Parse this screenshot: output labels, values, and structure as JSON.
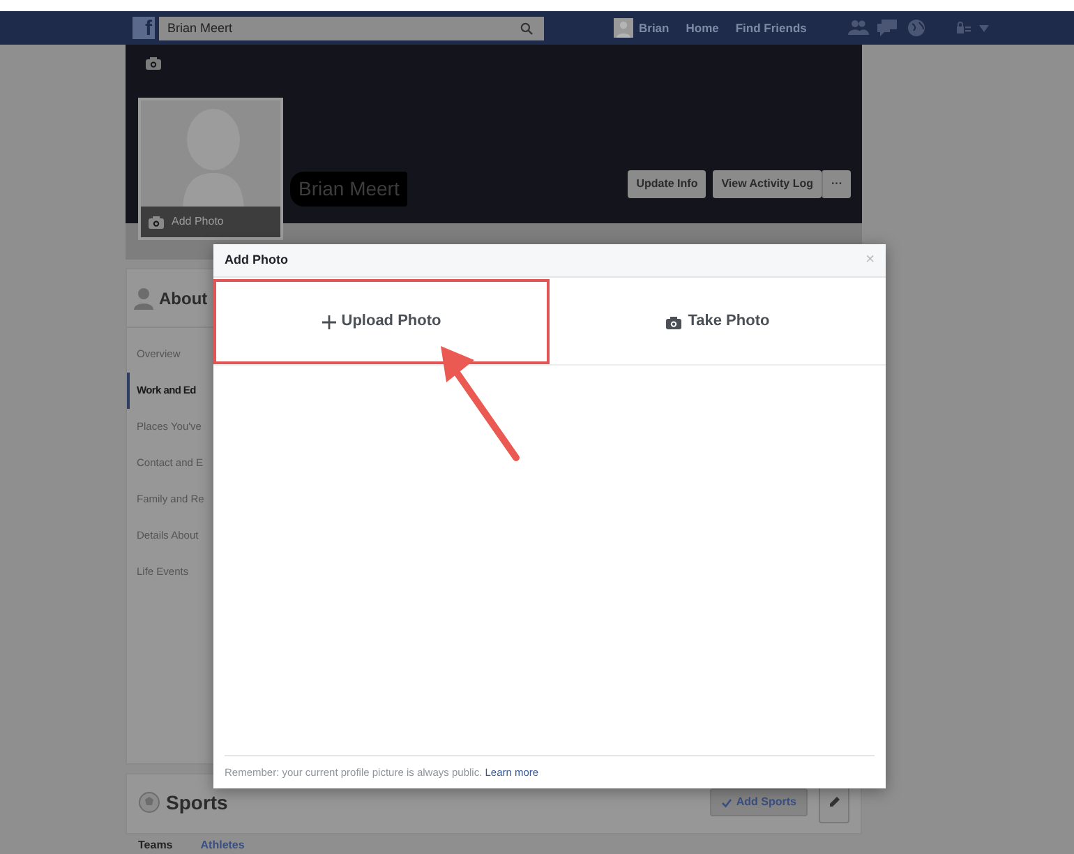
{
  "topbar": {
    "logo": "f",
    "search": {
      "value": "Brian Meert"
    },
    "user": "Brian",
    "links": [
      "Home",
      "Find Friends"
    ]
  },
  "profile": {
    "name": "Brian Meert",
    "add_photo": "Add Photo",
    "buttons": [
      "Update Info",
      "View Activity Log"
    ],
    "more": "···"
  },
  "about": {
    "title": "About",
    "items": [
      {
        "label": "Overview",
        "selected": false
      },
      {
        "label": "Work and Ed",
        "selected": true
      },
      {
        "label": "Places You've",
        "selected": false
      },
      {
        "label": "Contact and E",
        "selected": false
      },
      {
        "label": "Family and Re",
        "selected": false
      },
      {
        "label": "Details About",
        "selected": false
      },
      {
        "label": "Life Events",
        "selected": false
      }
    ]
  },
  "sports": {
    "title": "Sports",
    "add_button": "Add Sports",
    "tabs": [
      {
        "label": "Teams",
        "selected": true
      },
      {
        "label": "Athletes",
        "selected": false
      }
    ]
  },
  "dialog": {
    "title": "Add Photo",
    "close": "×",
    "options": [
      {
        "label": "Upload Photo",
        "kind": "upload",
        "highlighted": true
      },
      {
        "label": "Take Photo",
        "kind": "camera",
        "highlighted": false
      }
    ],
    "note": "Remember: your current profile picture is always public.",
    "link": "Learn more"
  }
}
